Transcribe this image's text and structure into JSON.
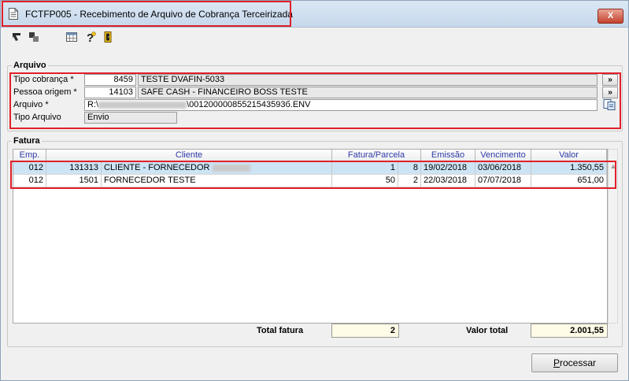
{
  "window": {
    "title": "FCTFP005 - Recebimento de Arquivo de Cobrança Terceirizada",
    "close_label": "X"
  },
  "toolbar": {
    "icons": [
      "back-arrow-icon",
      "fwd-step-icon",
      "calendar-grid-icon",
      "help-icon",
      "exit-door-icon"
    ]
  },
  "arquivo": {
    "legend": "Arquivo",
    "tipo_cobranca": {
      "label": "Tipo cobrança *",
      "code": "8459",
      "desc": "TESTE DVAFIN-5033",
      "lookup": "»"
    },
    "pessoa_origem": {
      "label": "Pessoa origem *",
      "code": "14103",
      "desc": "SAFE CASH - FINANCEIRO BOSS TESTE",
      "lookup": "»"
    },
    "arquivo": {
      "label": "Arquivo *",
      "prefix": "R:\\",
      "suffix": "\\00120000085521543593б.ENV"
    },
    "tipo_arquivo": {
      "label": "Tipo Arquivo",
      "value": "Envio"
    }
  },
  "fatura": {
    "legend": "Fatura",
    "columns": [
      "Emp.",
      "Cliente",
      "Fatura/Parcela",
      "Emissão",
      "Vencimento",
      "Valor"
    ],
    "rows": [
      {
        "emp": "012",
        "codigo": "131313",
        "cliente": "CLIENTE - FORNECEDOR",
        "fatura": "1",
        "parcela": "8",
        "emissao": "19/02/2018",
        "vencimento": "03/06/2018",
        "valor": "1.350,55"
      },
      {
        "emp": "012",
        "codigo": "1501",
        "cliente": "FORNECEDOR TESTE",
        "fatura": "50",
        "parcela": "2",
        "emissao": "22/03/2018",
        "vencimento": "07/07/2018",
        "valor": "651,00"
      }
    ]
  },
  "totals": {
    "total_fatura_label": "Total fatura",
    "total_fatura": "2",
    "valor_total_label": "Valor total",
    "valor_total": "2.001,55"
  },
  "actions": {
    "processar_first": "P",
    "processar_rest": "rocessar"
  },
  "colors": {
    "highlight_border": "#e0202a",
    "selected_row": "#cde4f5",
    "header_text": "#2d3aa6",
    "total_bg": "#fffbe6"
  }
}
